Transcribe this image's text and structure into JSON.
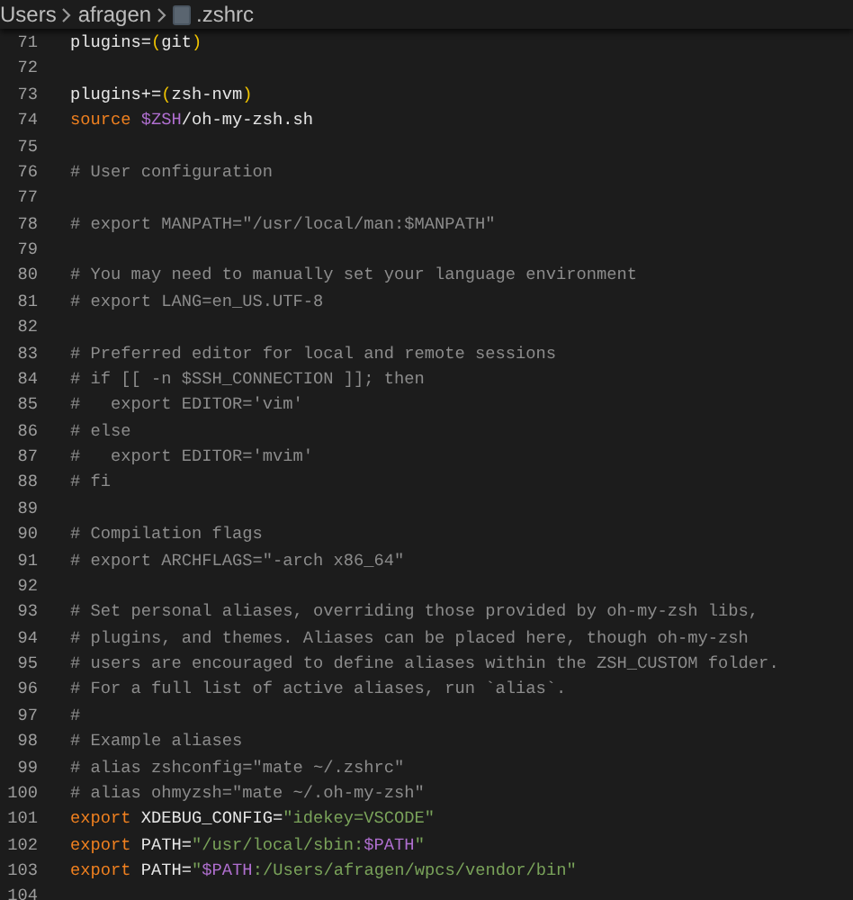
{
  "breadcrumb": [
    {
      "label": "Users",
      "kind": "folder"
    },
    {
      "label": "afragen",
      "kind": "folder"
    },
    {
      "label": ".zshrc",
      "kind": "file"
    }
  ],
  "lines": [
    {
      "number": "71",
      "tokens": [
        {
          "kind": "plain",
          "text": "plugins="
        },
        {
          "kind": "paren",
          "text": "("
        },
        {
          "kind": "plain",
          "text": "git"
        },
        {
          "kind": "paren",
          "text": ")"
        }
      ]
    },
    {
      "number": "72"
    },
    {
      "number": "73",
      "tokens": [
        {
          "kind": "plain",
          "text": "plugins+="
        },
        {
          "kind": "paren",
          "text": "("
        },
        {
          "kind": "plain",
          "text": "zsh-nvm"
        },
        {
          "kind": "paren",
          "text": ")"
        }
      ]
    },
    {
      "number": "74",
      "tokens": [
        {
          "kind": "keyword",
          "text": "source "
        },
        {
          "kind": "variable",
          "text": "$ZSH"
        },
        {
          "kind": "plain",
          "text": "/oh-my-zsh.sh"
        }
      ]
    },
    {
      "number": "75"
    },
    {
      "number": "76",
      "tokens": [
        {
          "kind": "comment",
          "text": "# User configuration"
        }
      ]
    },
    {
      "number": "77"
    },
    {
      "number": "78",
      "tokens": [
        {
          "kind": "comment",
          "text": "# export MANPATH=\"/usr/local/man:$MANPATH\""
        }
      ]
    },
    {
      "number": "79"
    },
    {
      "number": "80",
      "tokens": [
        {
          "kind": "comment",
          "text": "# You may need to manually set your language environment"
        }
      ]
    },
    {
      "number": "81",
      "tokens": [
        {
          "kind": "comment",
          "text": "# export LANG=en_US.UTF-8"
        }
      ]
    },
    {
      "number": "82"
    },
    {
      "number": "83",
      "tokens": [
        {
          "kind": "comment",
          "text": "# Preferred editor for local and remote sessions"
        }
      ]
    },
    {
      "number": "84",
      "tokens": [
        {
          "kind": "comment",
          "text": "# if [[ -n $SSH_CONNECTION ]]; then"
        }
      ]
    },
    {
      "number": "85",
      "tokens": [
        {
          "kind": "comment",
          "text": "#   export EDITOR='vim'"
        }
      ]
    },
    {
      "number": "86",
      "tokens": [
        {
          "kind": "comment",
          "text": "# else"
        }
      ]
    },
    {
      "number": "87",
      "tokens": [
        {
          "kind": "comment",
          "text": "#   export EDITOR='mvim'"
        }
      ]
    },
    {
      "number": "88",
      "tokens": [
        {
          "kind": "comment",
          "text": "# fi"
        }
      ]
    },
    {
      "number": "89"
    },
    {
      "number": "90",
      "tokens": [
        {
          "kind": "comment",
          "text": "# Compilation flags"
        }
      ]
    },
    {
      "number": "91",
      "tokens": [
        {
          "kind": "comment",
          "text": "# export ARCHFLAGS=\"-arch x86_64\""
        }
      ]
    },
    {
      "number": "92"
    },
    {
      "number": "93",
      "tokens": [
        {
          "kind": "comment",
          "text": "# Set personal aliases, overriding those provided by oh-my-zsh libs,"
        }
      ]
    },
    {
      "number": "94",
      "tokens": [
        {
          "kind": "comment",
          "text": "# plugins, and themes. Aliases can be placed here, though oh-my-zsh"
        }
      ]
    },
    {
      "number": "95",
      "tokens": [
        {
          "kind": "comment",
          "text": "# users are encouraged to define aliases within the ZSH_CUSTOM folder."
        }
      ]
    },
    {
      "number": "96",
      "tokens": [
        {
          "kind": "comment",
          "text": "# For a full list of active aliases, run `alias`."
        }
      ]
    },
    {
      "number": "97",
      "tokens": [
        {
          "kind": "comment",
          "text": "#"
        }
      ]
    },
    {
      "number": "98",
      "tokens": [
        {
          "kind": "comment",
          "text": "# Example aliases"
        }
      ]
    },
    {
      "number": "99",
      "tokens": [
        {
          "kind": "comment",
          "text": "# alias zshconfig=\"mate ~/.zshrc\""
        }
      ]
    },
    {
      "number": "100",
      "tokens": [
        {
          "kind": "comment",
          "text": "# alias ohmyzsh=\"mate ~/.oh-my-zsh\""
        }
      ]
    },
    {
      "number": "101",
      "tokens": [
        {
          "kind": "keyword",
          "text": "export "
        },
        {
          "kind": "plain",
          "text": "XDEBUG_CONFIG="
        },
        {
          "kind": "string",
          "text": "\"idekey=VSCODE\""
        }
      ]
    },
    {
      "number": "102",
      "tokens": [
        {
          "kind": "keyword",
          "text": "export "
        },
        {
          "kind": "plain",
          "text": "PATH="
        },
        {
          "kind": "string",
          "text": "\"/usr/local/sbin:"
        },
        {
          "kind": "variable",
          "text": "$PATH"
        },
        {
          "kind": "string",
          "text": "\""
        }
      ]
    },
    {
      "number": "103",
      "tokens": [
        {
          "kind": "keyword",
          "text": "export "
        },
        {
          "kind": "plain",
          "text": "PATH="
        },
        {
          "kind": "string",
          "text": "\""
        },
        {
          "kind": "variable",
          "text": "$PATH"
        },
        {
          "kind": "string",
          "text": ":/Users/afragen/wpcs/vendor/bin\""
        }
      ]
    },
    {
      "number": "104"
    }
  ]
}
